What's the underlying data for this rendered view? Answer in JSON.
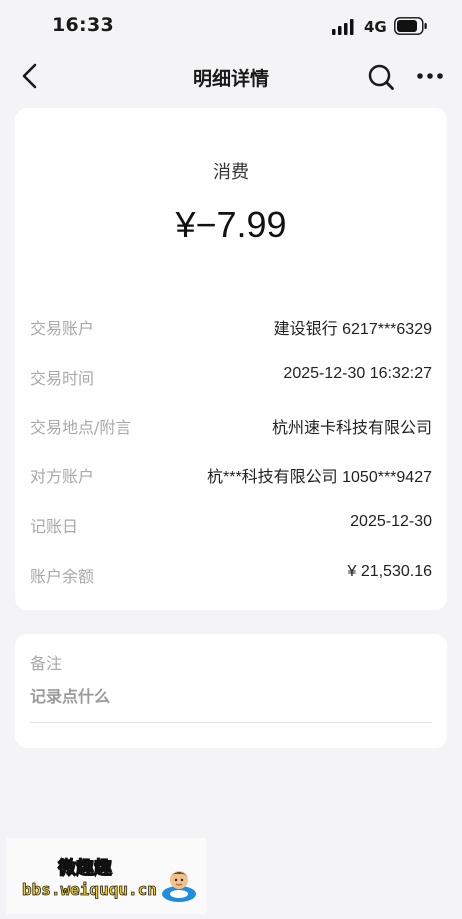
{
  "status_bar": {
    "time": "16:33",
    "network": "4G",
    "icons": [
      "signal-icon",
      "battery-icon"
    ]
  },
  "nav": {
    "title": "明细详情",
    "icons": [
      "back-icon",
      "search-icon",
      "more-icon"
    ]
  },
  "transaction": {
    "type": "消费",
    "amount": "¥−7.99",
    "rows": [
      {
        "label": "交易账户",
        "value": "建设银行 6217***6329"
      },
      {
        "label": "交易时间",
        "value": "2025-12-30 16:32:27"
      },
      {
        "label": "交易地点/附言",
        "value": "杭州速卡科技有限公司"
      },
      {
        "label": "对方账户",
        "value": "杭***科技有限公司 1050***9427"
      },
      {
        "label": "记账日",
        "value": "2025-12-30"
      },
      {
        "label": "账户余额",
        "value": "¥ 21,530.16"
      }
    ]
  },
  "note": {
    "label": "备注",
    "placeholder": "记录点什么"
  },
  "watermark": {
    "line1": "微趣趣",
    "line2": "bbs.weiququ.cn"
  },
  "colors": {
    "page_bg": "#f4f4f6",
    "card_bg": "#ffffff",
    "label_gray": "#a9a9a9",
    "text_dark": "#1a1a1a"
  }
}
